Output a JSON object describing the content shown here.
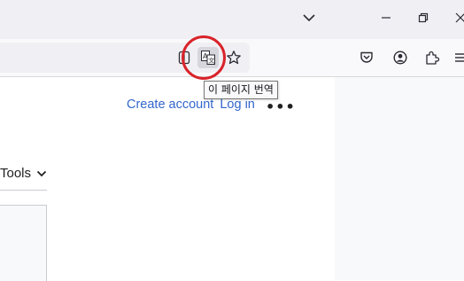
{
  "colors": {
    "link": "#3366cc",
    "highlight_ring": "#d9232a",
    "titlebar": "#f0f0f4"
  },
  "window_controls": {
    "icons": [
      "tab-list-chevron-icon",
      "minimize-icon",
      "restore-icon",
      "close-icon"
    ]
  },
  "toolbar_icons": [
    "reader-view-icon",
    "translate-page-icon",
    "bookmark-star-icon",
    "pocket-icon",
    "account-icon",
    "extensions-icon",
    "menu-icon"
  ],
  "tooltip": {
    "text": "이 페이지 번역"
  },
  "header_links": {
    "create_account": "Create account",
    "log_in": "Log in",
    "more": "•••"
  },
  "tools_menu": {
    "label": "Tools"
  }
}
